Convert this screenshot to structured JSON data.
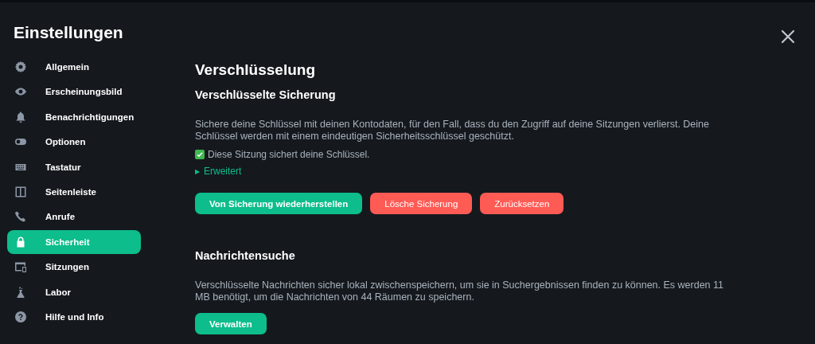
{
  "dialog": {
    "title": "Einstellungen"
  },
  "sidebar": {
    "items": [
      {
        "kind": "gear",
        "label": "Allgemein",
        "selected": false
      },
      {
        "kind": "eye",
        "label": "Erscheinungsbild",
        "selected": false
      },
      {
        "kind": "bell",
        "label": "Benachrichtigungen",
        "selected": false
      },
      {
        "kind": "toggle",
        "label": "Optionen",
        "selected": false
      },
      {
        "kind": "keyboard",
        "label": "Tastatur",
        "selected": false
      },
      {
        "kind": "sidebar",
        "label": "Seitenleiste",
        "selected": false
      },
      {
        "kind": "phone",
        "label": "Anrufe",
        "selected": false
      },
      {
        "kind": "lock",
        "label": "Sicherheit",
        "selected": true
      },
      {
        "kind": "devices",
        "label": "Sitzungen",
        "selected": false
      },
      {
        "kind": "flask",
        "label": "Labor",
        "selected": false
      },
      {
        "kind": "help",
        "label": "Hilfe und Info",
        "selected": false
      }
    ]
  },
  "content": {
    "heading": "Verschlüsselung",
    "sections": [
      {
        "title": "Verschlüsselte Sicherung",
        "description": "Sichere deine Schlüssel mit deinen Kontodaten, für den Fall, dass du den Zugriff auf deine Sitzungen verlierst. Deine Schlüssel werden mit einem eindeutigen Sicherheitsschlüssel geschützt.",
        "status": {
          "checked": true,
          "text": "Diese Sitzung sichert deine Schlüssel."
        },
        "disclosure": {
          "marker": "▶",
          "label": "Erweitert",
          "expanded": false
        },
        "buttons": [
          {
            "kind": "primary",
            "label": "Von Sicherung wiederherstellen"
          },
          {
            "kind": "danger",
            "label": "Lösche Sicherung"
          },
          {
            "kind": "danger",
            "label": "Zurücksetzen"
          }
        ]
      },
      {
        "title": "Nachrichtensuche",
        "description": "Verschlüsselte Nachrichten sicher lokal zwischenspeichern, um sie in Suchergebnissen finden zu können. Es werden 11 MB benötigt, um die Nachrichten von 44 Räumen zu speichern.",
        "buttons": [
          {
            "kind": "primary",
            "label": "Verwalten"
          }
        ]
      }
    ]
  }
}
